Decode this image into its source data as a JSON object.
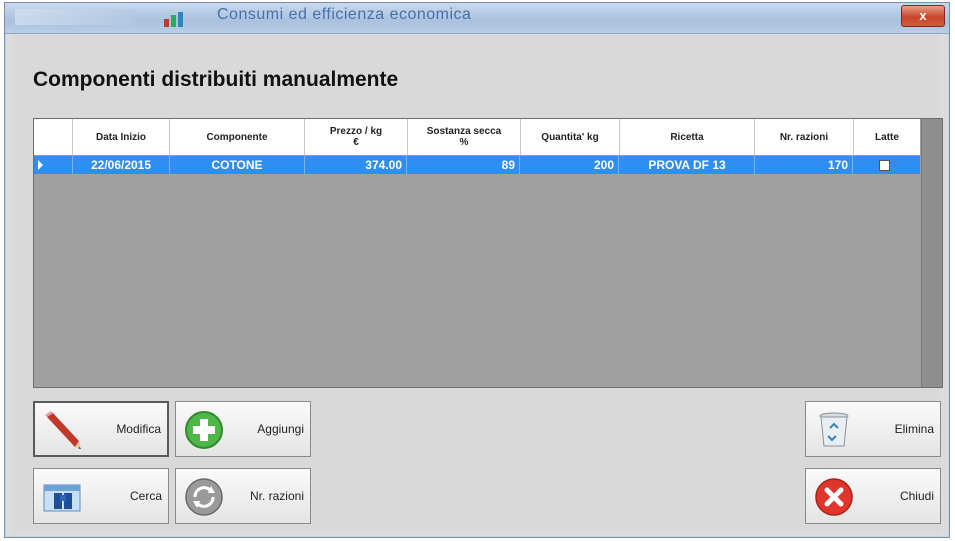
{
  "window": {
    "title": "Consumi ed efficienza economica",
    "close_label": "x"
  },
  "page": {
    "heading": "Componenti distribuiti manualmente"
  },
  "table": {
    "columns": [
      "",
      "Data Inizio",
      "Componente",
      "Prezzo / kg\n€",
      "Sostanza secca\n%",
      "Quantita' kg",
      "Ricetta",
      "Nr. razioni",
      "Latte"
    ],
    "rows": [
      {
        "data_inizio": "22/06/2015",
        "componente": "COTONE",
        "prezzo": "374.00",
        "sostanza_secca": "89",
        "quantita": "200",
        "ricetta": "PROVA DF 13",
        "nr_razioni": "170",
        "latte": false
      }
    ]
  },
  "buttons": {
    "modifica": "Modifica",
    "aggiungi": "Aggiungi",
    "cerca": "Cerca",
    "nr_razioni": "Nr. razioni",
    "elimina": "Elimina",
    "chiudi": "Chiudi"
  },
  "icons": {
    "modifica": "pencil-icon",
    "aggiungi": "plus-circle-icon",
    "cerca": "binoculars-icon",
    "nr_razioni": "refresh-icon",
    "elimina": "recycle-bin-icon",
    "chiudi": "close-circle-icon"
  },
  "colors": {
    "selection": "#2f8ef2",
    "grid_background": "#a0a0a0",
    "window_background": "#d9d9d9"
  }
}
